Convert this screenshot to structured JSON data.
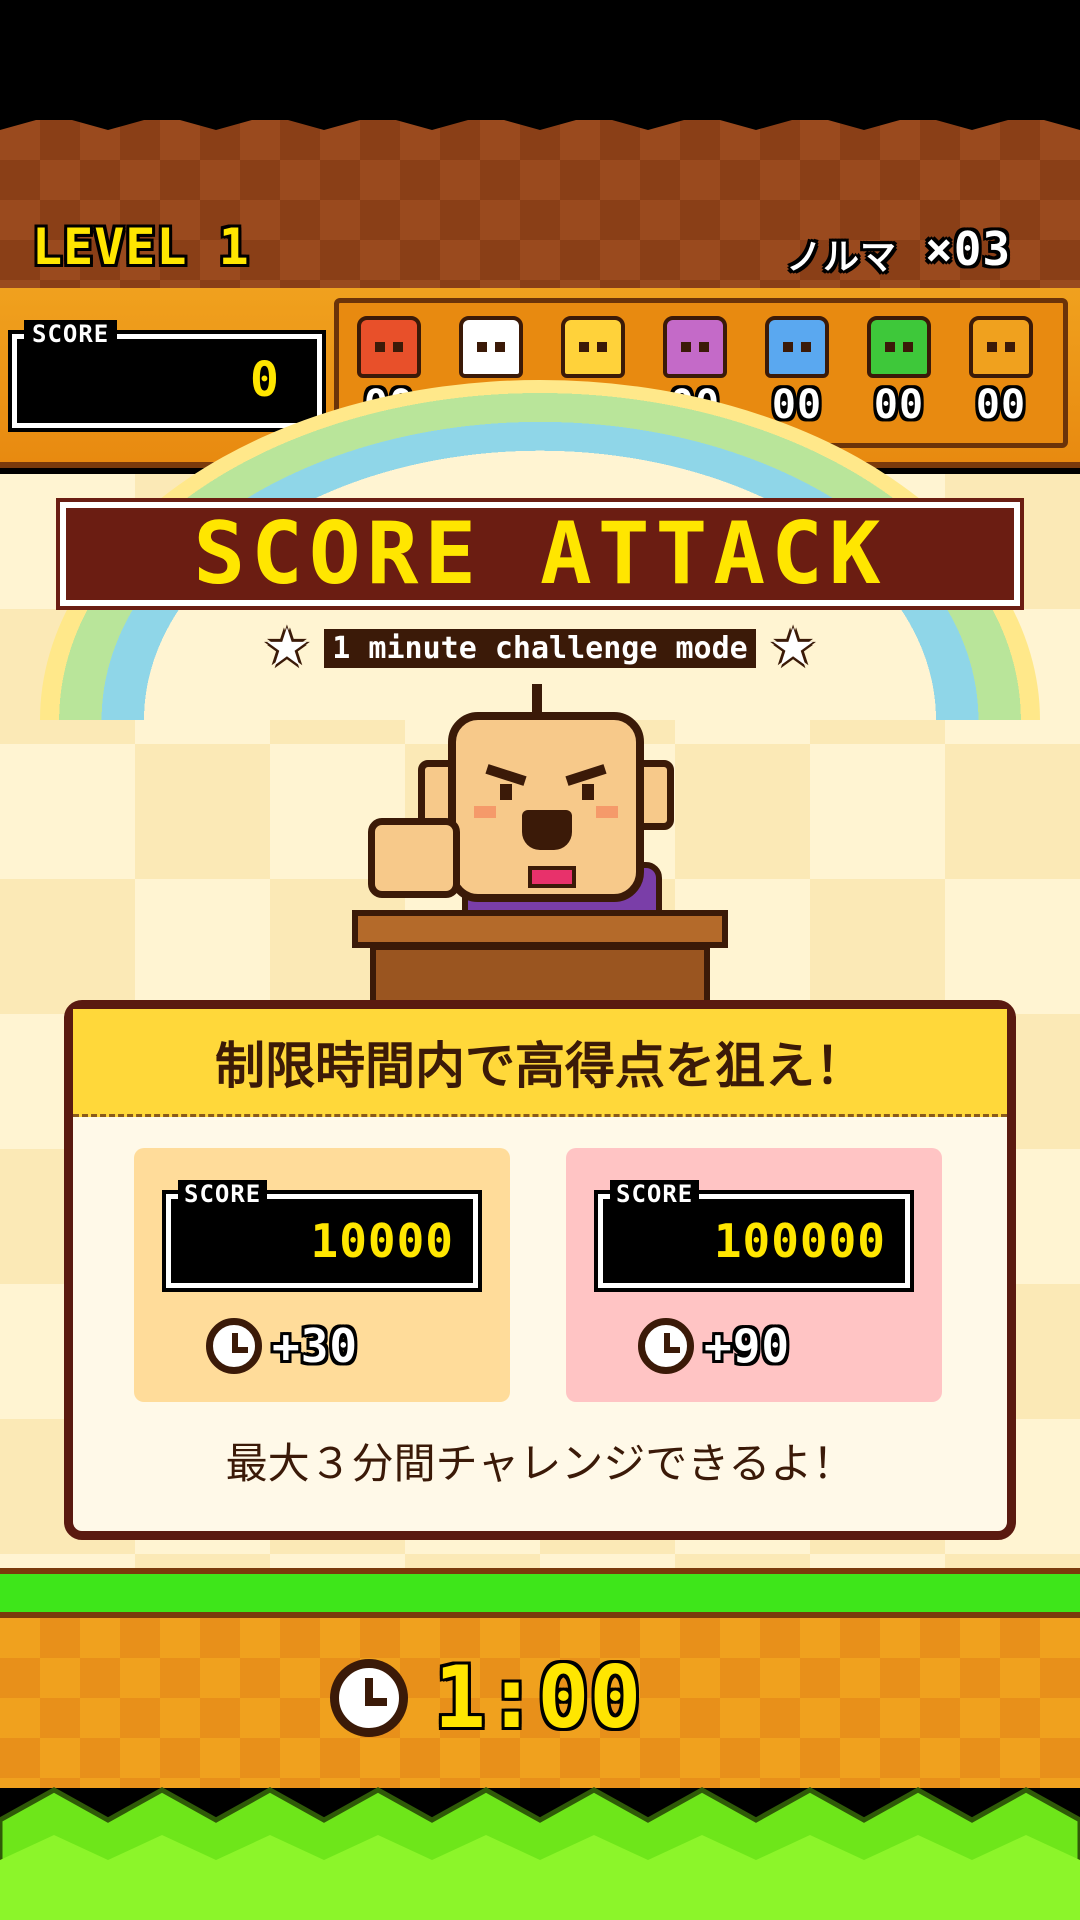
{
  "header": {
    "level_label": "LEVEL 1",
    "quota_label": "ノルマ",
    "quota_value": "×03"
  },
  "score_panel": {
    "label": "SCORE",
    "value": "0"
  },
  "monsters": [
    {
      "icon": "red-monster-icon",
      "color": "#e8502a",
      "count": "00"
    },
    {
      "icon": "panda-monster-icon",
      "color": "#ffffff",
      "count": "00"
    },
    {
      "icon": "giraffe-monster-icon",
      "color": "#ffd23a",
      "count": "00"
    },
    {
      "icon": "purple-monster-icon",
      "color": "#c46ac8",
      "count": "00"
    },
    {
      "icon": "blue-jellyfish-icon",
      "color": "#5aa8f0",
      "count": "00"
    },
    {
      "icon": "green-frog-monster-icon",
      "color": "#3ec83a",
      "count": "00"
    },
    {
      "icon": "gold-block-monster-icon",
      "color": "#f0a11e",
      "count": "00"
    }
  ],
  "title": {
    "main": "SCORE ATTACK",
    "subtitle": "1 minute challenge mode"
  },
  "info": {
    "header": "制限時間内で高得点を狙え！",
    "rewards": [
      {
        "score_label": "SCORE",
        "score": "10000",
        "time_bonus": "+30",
        "bg": "#ffdc9a"
      },
      {
        "score_label": "SCORE",
        "score": "100000",
        "time_bonus": "+90",
        "bg": "#ffc4c4"
      }
    ],
    "footer": "最大３分間チャレンジできるよ！"
  },
  "timer": {
    "value": "1:00"
  }
}
